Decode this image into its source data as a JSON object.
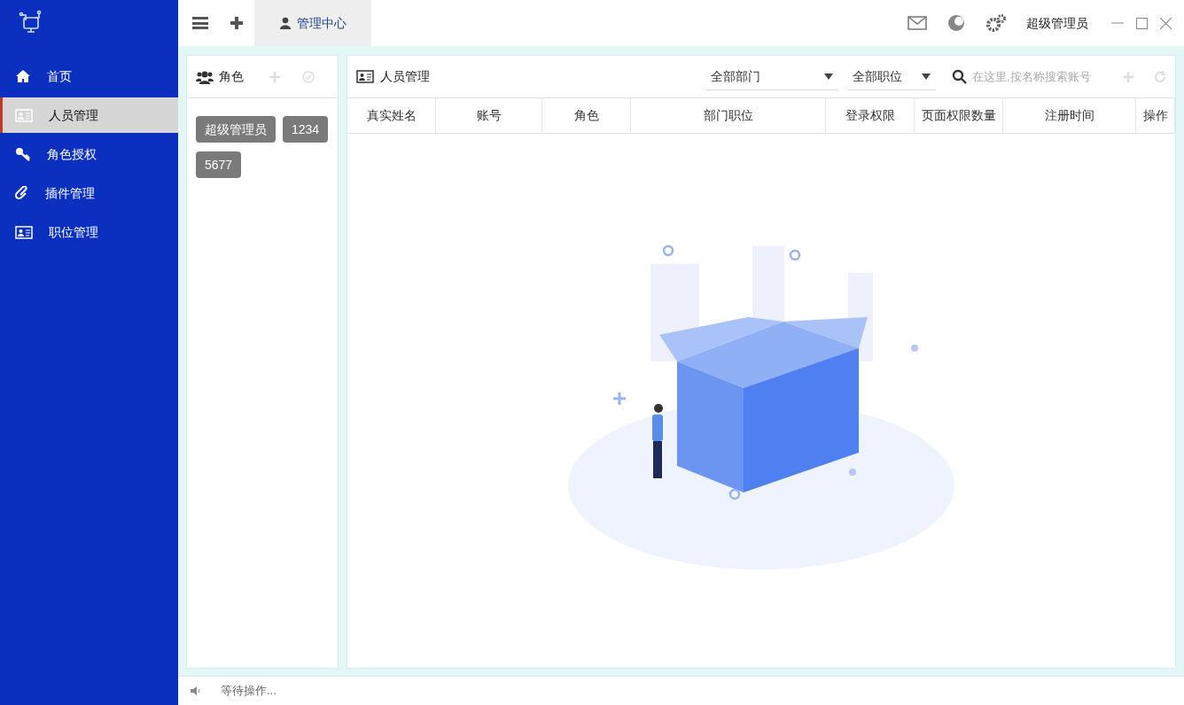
{
  "sidebar": {
    "items": [
      {
        "label": "首页",
        "selected": false
      },
      {
        "label": "人员管理",
        "selected": true
      },
      {
        "label": "角色授权",
        "selected": false
      },
      {
        "label": "插件管理",
        "selected": false
      },
      {
        "label": "职位管理",
        "selected": false
      }
    ]
  },
  "top_bar": {
    "tabs": [
      {
        "label": "管理中心",
        "selected": true
      }
    ],
    "user_name": "超级管理员"
  },
  "roles_panel": {
    "title": "角色",
    "tags": [
      "超级管理员",
      "1234",
      "5677"
    ]
  },
  "staff_panel": {
    "title": "人员管理",
    "department_filter": "全部部门",
    "position_filter": "全部职位",
    "search": {
      "placeholder": "在这里,按名称搜索账号"
    },
    "table": {
      "columns": [
        "真实姓名",
        "账号",
        "角色",
        "部门职位",
        "登录权限",
        "页面权限数量",
        "注册时间",
        "操作"
      ]
    }
  },
  "status_bar": {
    "text": "等待操作..."
  }
}
